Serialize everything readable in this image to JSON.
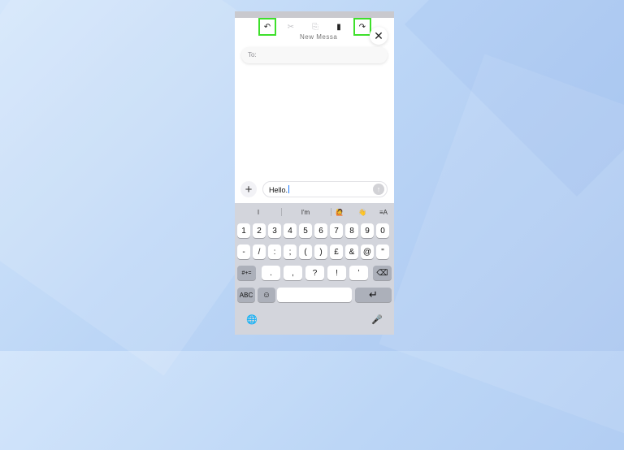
{
  "toolbar": {
    "undo_icon": "↶",
    "cut_icon": "✂",
    "copy_icon": "⎘",
    "paste_icon": "▮",
    "redo_icon": "↷",
    "ghost_title": "New Message",
    "close_icon": "✕",
    "highlight_color": "#3ee02b"
  },
  "recipient": {
    "label": "To:"
  },
  "compose": {
    "plus_icon": "+",
    "message_text": "Hello.",
    "send_icon": "↑"
  },
  "suggestions": [
    "I",
    "I'm",
    "🙋",
    "👋",
    "≡A"
  ],
  "keyboard": {
    "row1": [
      "1",
      "2",
      "3",
      "4",
      "5",
      "6",
      "7",
      "8",
      "9",
      "0"
    ],
    "row2": [
      "-",
      "/",
      ":",
      ";",
      "(",
      ")",
      "£",
      "&",
      "@",
      "\""
    ],
    "row3_toggle": "#+=",
    "row3": [
      ".",
      ",",
      "?",
      "!",
      "’"
    ],
    "backspace_icon": "⌫",
    "abc_label": "ABC",
    "emoji_icon": "☺",
    "return_icon": "↵",
    "globe_icon": "🌐",
    "mic_icon": "🎤"
  }
}
